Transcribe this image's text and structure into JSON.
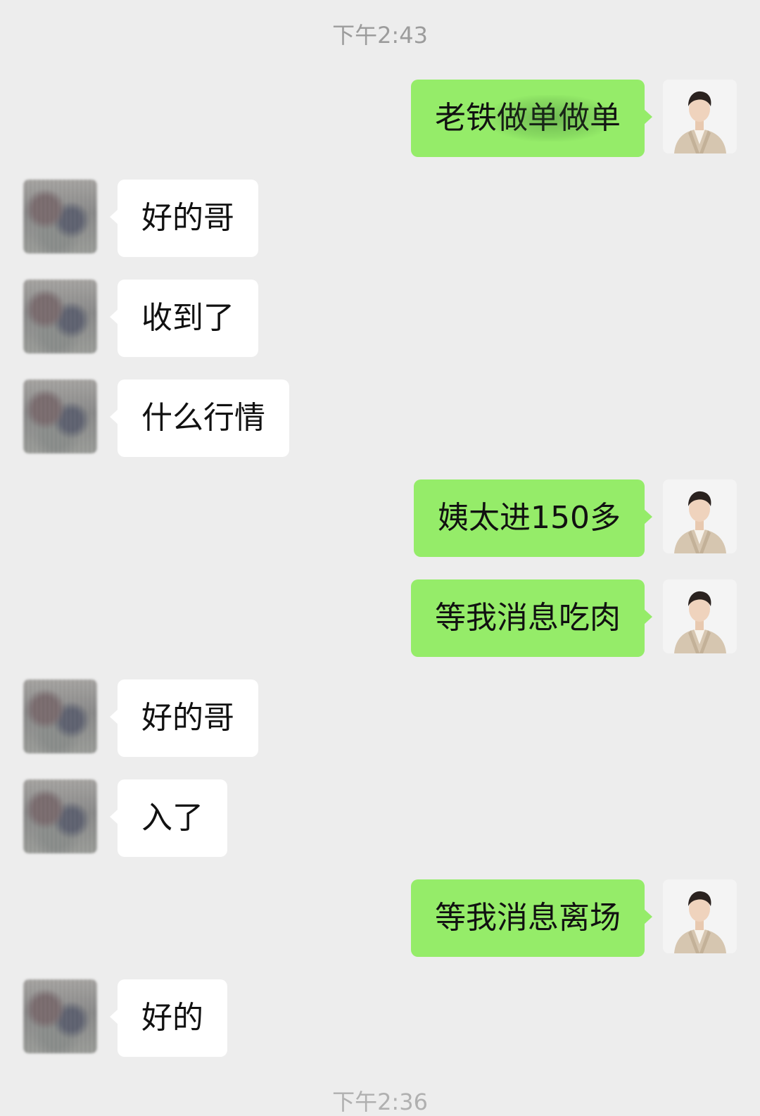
{
  "timestamps": {
    "top": "下午2:43",
    "bottom": "下午2:36"
  },
  "messages": [
    {
      "side": "right",
      "text": "老铁做单做单"
    },
    {
      "side": "left",
      "text": "好的哥"
    },
    {
      "side": "left",
      "text": "收到了"
    },
    {
      "side": "left",
      "text": "什么行情"
    },
    {
      "side": "right",
      "text": "姨太进150多"
    },
    {
      "side": "right",
      "text": "等我消息吃肉"
    },
    {
      "side": "left",
      "text": "好的哥"
    },
    {
      "side": "left",
      "text": "入了"
    },
    {
      "side": "right",
      "text": "等我消息离场"
    },
    {
      "side": "left",
      "text": "好的"
    }
  ],
  "colors": {
    "background": "#ededed",
    "sent_bubble": "#95ec69",
    "received_bubble": "#ffffff",
    "timestamp_text": "#9c9c9c"
  },
  "icons": {
    "self_avatar": "man-in-beige-suit-avatar",
    "contact_avatar": "blurred-photo-avatar"
  }
}
